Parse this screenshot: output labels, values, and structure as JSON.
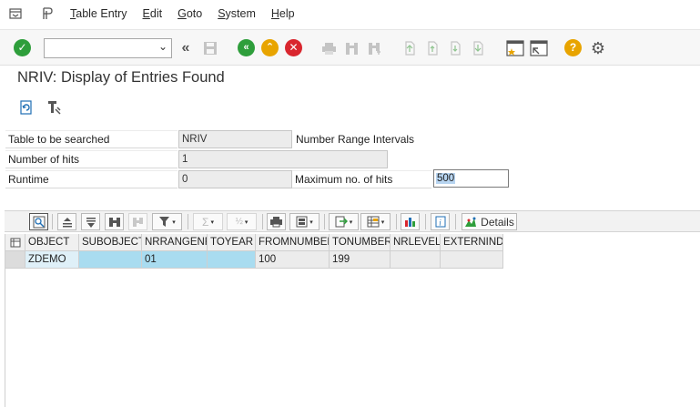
{
  "menu": {
    "items": [
      {
        "label": "Table Entry",
        "accel": "T",
        "rest": "able Entry"
      },
      {
        "label": "Edit",
        "accel": "E",
        "rest": "dit"
      },
      {
        "label": "Goto",
        "accel": "G",
        "rest": "oto"
      },
      {
        "label": "System",
        "accel": "S",
        "rest": "ystem"
      },
      {
        "label": "Help",
        "accel": "H",
        "rest": "elp"
      }
    ]
  },
  "toolbar": {
    "command_value": "",
    "colors": {
      "enter": "#2e9e3b",
      "back": "#2e9e3b",
      "exit": "#e8a400",
      "cancel": "#d9262e",
      "help": "#e8a400"
    }
  },
  "page": {
    "title": "NRIV: Display of Entries Found"
  },
  "form": {
    "table_label": "Table to be searched",
    "table_value": "NRIV",
    "table_desc": "Number Range Intervals",
    "hits_label": "Number of hits",
    "hits_value": "1",
    "runtime_label": "Runtime",
    "runtime_value": "0",
    "maxhits_label": "Maximum no. of hits",
    "maxhits_value": "500"
  },
  "alv": {
    "details_label": "Details",
    "columns": [
      "OBJECT",
      "SUBOBJECT",
      "NRRANGENR",
      "TOYEAR",
      "FROMNUMBER",
      "TONUMBER",
      "NRLEVEL",
      "EXTERNIND"
    ],
    "rows": [
      [
        "ZDEMO",
        "",
        "01",
        "",
        "100",
        "199",
        "",
        ""
      ]
    ]
  }
}
